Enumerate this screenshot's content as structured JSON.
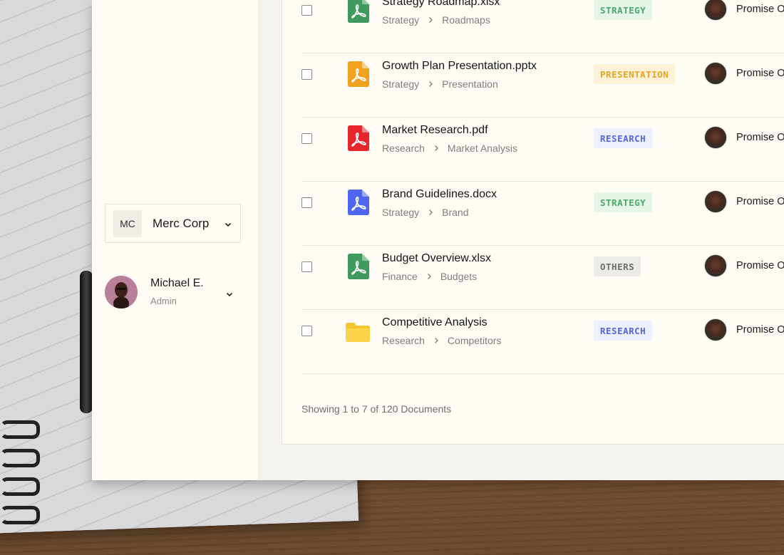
{
  "sidebar": {
    "org": {
      "initials": "MC",
      "name": "Merc Corp"
    },
    "user": {
      "name": "Michael E.",
      "role": "Admin"
    }
  },
  "documents": [
    {
      "name": "Strategy Roadmap.xlsx",
      "path": [
        "Strategy",
        "Roadmaps"
      ],
      "tag": "STRATEGY",
      "icon": "xlsx-file-icon",
      "icon_color": "#3f9a5e",
      "tag_fg": "#4aa86a",
      "tag_bg": "#e6f5e8",
      "owner": "Promise O"
    },
    {
      "name": "Growth Plan Presentation.pptx",
      "path": [
        "Strategy",
        "Presentation"
      ],
      "tag": "PRESENTATION",
      "icon": "pptx-file-icon",
      "icon_color": "#f0a21f",
      "tag_fg": "#e6a523",
      "tag_bg": "#fdf1d6",
      "owner": "Promise O"
    },
    {
      "name": "Market Research.pdf",
      "path": [
        "Research",
        "Market Analysis"
      ],
      "tag": "RESEARCH",
      "icon": "pdf-file-icon",
      "icon_color": "#e5262c",
      "tag_fg": "#5468d8",
      "tag_bg": "#eceffd",
      "owner": "Promise O"
    },
    {
      "name": "Brand Guidelines.docx",
      "path": [
        "Strategy",
        "Brand"
      ],
      "tag": "STRATEGY",
      "icon": "docx-file-icon",
      "icon_color": "#4f66f0",
      "tag_fg": "#4aa86a",
      "tag_bg": "#e6f5e8",
      "owner": "Promise O"
    },
    {
      "name": "Budget Overview.xlsx",
      "path": [
        "Finance",
        "Budgets"
      ],
      "tag": "OTHERS",
      "icon": "xlsx-file-icon",
      "icon_color": "#3f9a5e",
      "tag_fg": "#6e6e6e",
      "tag_bg": "#ecebe7",
      "owner": "Promise O"
    },
    {
      "name": "Competitive Analysis",
      "path": [
        "Research",
        "Competitors"
      ],
      "tag": "RESEARCH",
      "icon": "folder-icon",
      "icon_color": "#f6c631",
      "tag_fg": "#5468d8",
      "tag_bg": "#eceffd",
      "owner": "Promise O"
    }
  ],
  "footer": {
    "showing": "Showing 1 to 7 of 120 Documents"
  }
}
